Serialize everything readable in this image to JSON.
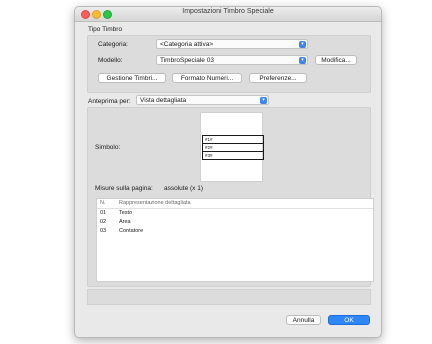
{
  "window": {
    "title": "Impostazioni Timbro Speciale"
  },
  "tipo_timbro": {
    "section_label": "Tipo Timbro",
    "categoria_label": "Categoria:",
    "categoria_value": "<Categoria attiva>",
    "modello_label": "Modello:",
    "modello_value": "TimbroSpeciale 03",
    "modifica_label": "Modifica...",
    "gestione_label": "Gestione Timbri...",
    "formato_label": "Formato Numeri...",
    "preferenze_label": "Preferenze..."
  },
  "anteprima": {
    "label": "Anteprima per:",
    "value": "Vista dettagliata",
    "simbolo_label": "Simbolo:",
    "symbol_rows": [
      "#1#",
      "#2#",
      "#3#"
    ],
    "misure_label": "Misure sulla pagina:",
    "misure_value": "assolute (x 1)"
  },
  "list": {
    "headers": [
      "N.",
      "Rappresentazione dettagliata"
    ],
    "rows": [
      {
        "n": "01",
        "label": "Testo"
      },
      {
        "n": "02",
        "label": "Area"
      },
      {
        "n": "03",
        "label": "Contatore"
      }
    ]
  },
  "footer": {
    "annulla_label": "Annulla",
    "ok_label": "OK"
  }
}
